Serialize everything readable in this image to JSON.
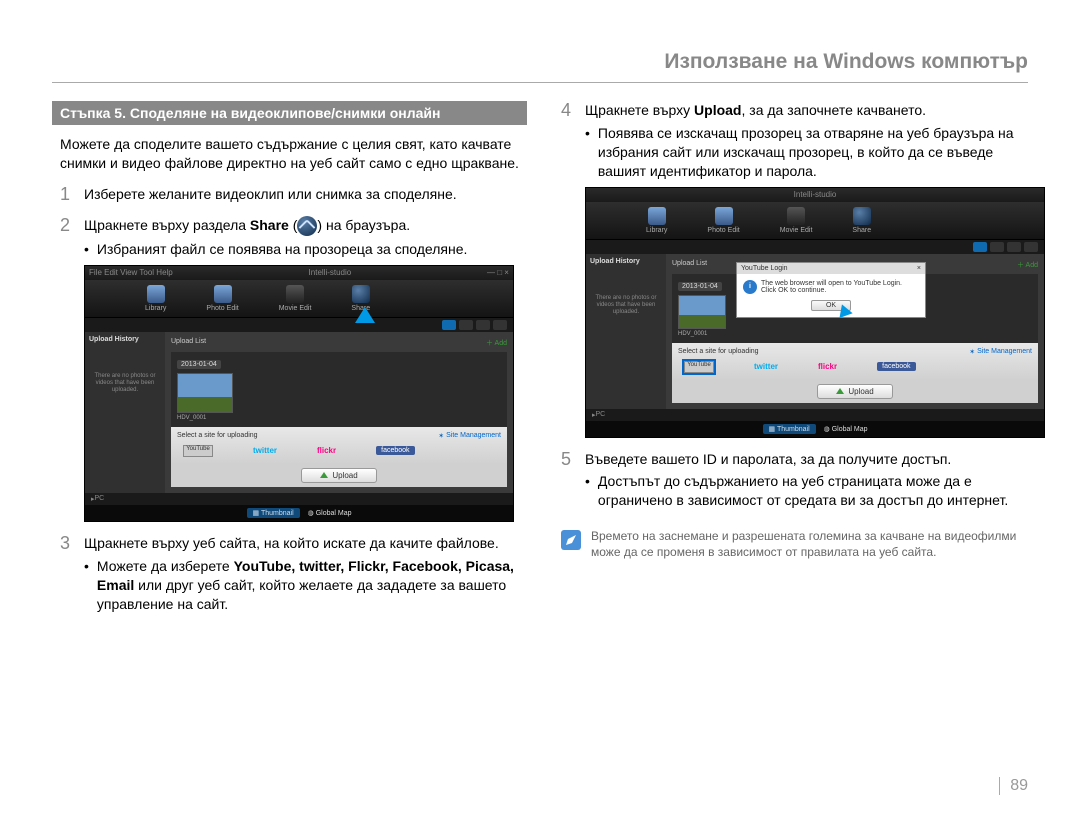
{
  "header": {
    "title": "Използване на Windows компютър"
  },
  "left": {
    "banner": "Стъпка 5. Споделяне на видеоклипове/снимки онлайн",
    "intro": "Можете да споделите вашето съдържание с целия свят, като качвате снимки и видео файлове директно на уеб сайт само с едно щракване.",
    "step1_num": "1",
    "step1": "Изберете желаните видеоклип или снимка за споделяне.",
    "step2_num": "2",
    "step2_a": "Щракнете върху раздела ",
    "step2_bold": "Share",
    "step2_b": " (",
    "step2_c": ") на браузъра.",
    "step2_sub": "Избраният файл се появява на прозореца за споделяне.",
    "shot1": {
      "app": "Intelli-studio",
      "tools": {
        "library": "Library",
        "photo": "Photo Edit",
        "movie": "Movie Edit",
        "share": "Share"
      },
      "side_h": "Upload History",
      "list_h": "Upload List",
      "date": "2013-01-04",
      "thumb_name": "HDV_0001",
      "empty": "There are no photos or videos that have been uploaded.",
      "select_label": "Select a site for uploading",
      "mgmt": "Site Management",
      "sites": {
        "youtube": "YouTube",
        "twitter": "twitter",
        "flickr": "flickr",
        "facebook": "facebook"
      },
      "upload": "Upload",
      "pc": "PC",
      "thumbnail": "Thumbnail",
      "global": "Global Map"
    },
    "step3_num": "3",
    "step3": "Щракнете върху уеб сайта, на който искате да качите файлове.",
    "step3_sub_a": "Можете да изберете ",
    "step3_sub_bold": "YouTube, twitter, Flickr, Facebook, Picasa, Email",
    "step3_sub_b": " или друг уеб сайт, който желаете да зададете за вашето управление на сайт."
  },
  "right": {
    "step4_num": "4",
    "step4_a": "Щракнете върху ",
    "step4_bold": "Upload",
    "step4_b": ", за да започнете качването.",
    "step4_sub": "Появява се изскачащ прозорец за отваряне на уеб браузъра на избрания сайт или изскачащ прозорец, в който да се въведе вашият идентификатор и парола.",
    "shot2": {
      "popup_title": "YouTube Login",
      "popup_msg": "The web browser will open to YouTube Login. Click OK to continue.",
      "ok": "OK"
    },
    "step5_num": "5",
    "step5": "Въведете вашето ID и паролата, за да получите достъп.",
    "step5_sub": "Достъпът до съдържанието на уеб страницата може да е ограничено в зависимост от средата ви за достъп до интернет.",
    "note": "Времето на заснемане и разрешената големина за качване на видеофилми може да се променя в зависимост от правилата на уеб сайта."
  },
  "page_number": "89"
}
